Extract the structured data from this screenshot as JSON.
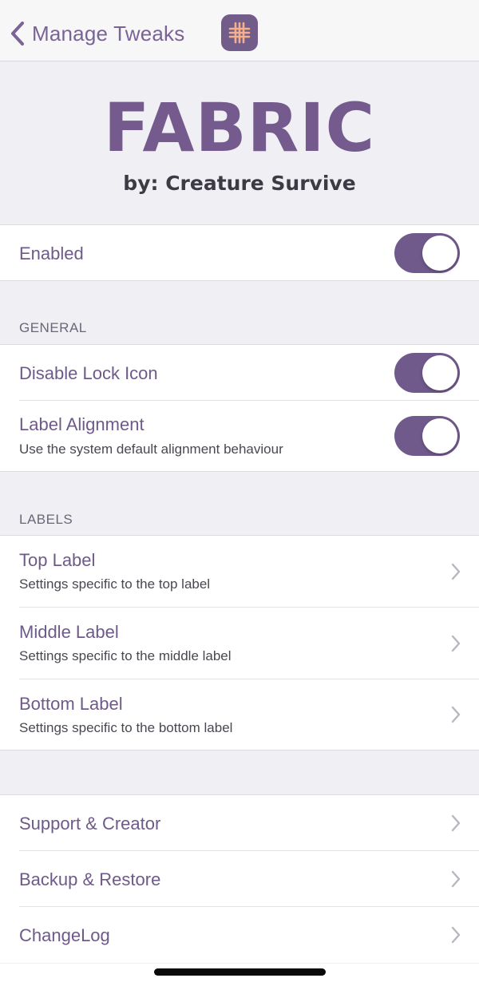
{
  "nav": {
    "back_label": "Manage Tweaks",
    "app_icon": "grid-icon",
    "accent": "#725c8a",
    "icon_glyph_color": "#f3b08a"
  },
  "header": {
    "title": "FABRIC",
    "subtitle": "by: Creature Survive"
  },
  "main_toggle": {
    "label": "Enabled",
    "on": true
  },
  "general": {
    "header": "GENERAL",
    "items": [
      {
        "label": "Disable Lock Icon",
        "on": true
      },
      {
        "label": "Label Alignment",
        "subtitle": "Use the system default alignment behaviour",
        "on": true
      }
    ]
  },
  "labels": {
    "header": "LABELS",
    "items": [
      {
        "label": "Top Label",
        "subtitle": "Settings specific to the top label"
      },
      {
        "label": "Middle Label",
        "subtitle": "Settings specific to the middle label"
      },
      {
        "label": "Bottom Label",
        "subtitle": "Settings specific to the bottom label"
      }
    ]
  },
  "links": {
    "items": [
      {
        "label": "Support & Creator"
      },
      {
        "label": "Backup & Restore"
      },
      {
        "label": "ChangeLog"
      }
    ]
  },
  "colors": {
    "toggle_on": "#705a8c",
    "background": "#efeff4",
    "text_accent": "#6e5a89"
  }
}
